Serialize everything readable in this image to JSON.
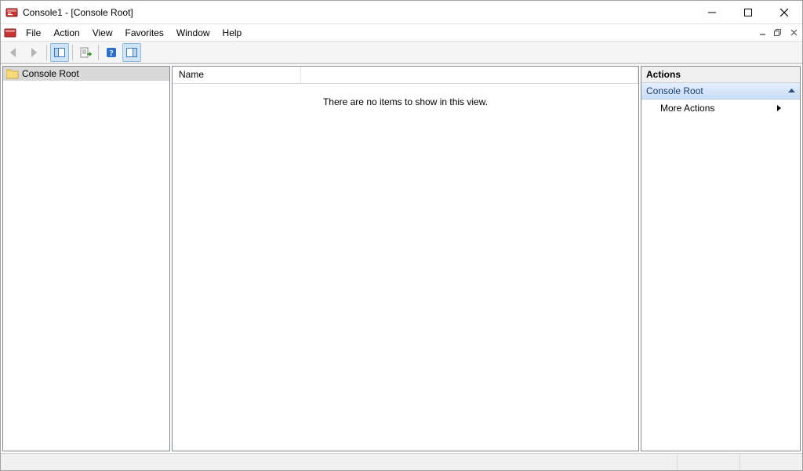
{
  "title": "Console1 - [Console Root]",
  "menu": {
    "file": "File",
    "action": "Action",
    "view": "View",
    "favorites": "Favorites",
    "window": "Window",
    "help": "Help"
  },
  "tree": {
    "root_label": "Console Root"
  },
  "list": {
    "col_name": "Name",
    "empty_text": "There are no items to show in this view."
  },
  "actions": {
    "title": "Actions",
    "section": "Console Root",
    "more_actions": "More Actions"
  }
}
